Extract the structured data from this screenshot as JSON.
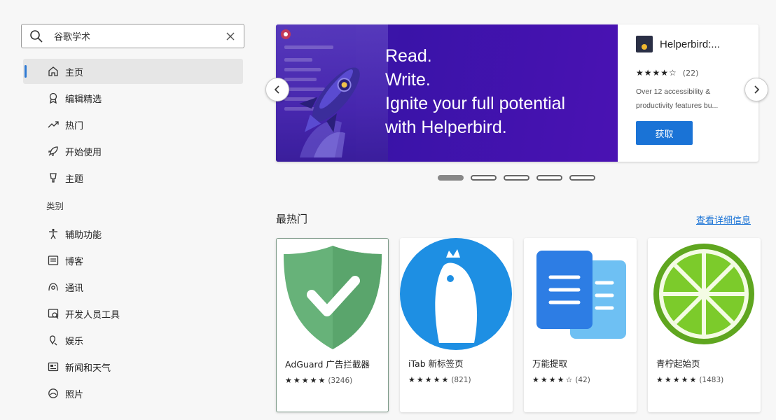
{
  "search": {
    "value": "谷歌学术"
  },
  "nav": {
    "items": [
      {
        "label": "主页",
        "icon": "home-icon",
        "active": true
      },
      {
        "label": "编辑精选",
        "icon": "award-icon"
      },
      {
        "label": "热门",
        "icon": "trending-icon"
      },
      {
        "label": "开始使用",
        "icon": "rocket-icon"
      },
      {
        "label": "主题",
        "icon": "theme-icon"
      }
    ],
    "category_heading": "类别",
    "categories": [
      {
        "label": "辅助功能",
        "icon": "accessibility-icon"
      },
      {
        "label": "博客",
        "icon": "blog-icon"
      },
      {
        "label": "通讯",
        "icon": "communication-icon"
      },
      {
        "label": "开发人员工具",
        "icon": "developer-tools-icon"
      },
      {
        "label": "娱乐",
        "icon": "entertainment-icon"
      },
      {
        "label": "新闻和天气",
        "icon": "news-icon"
      },
      {
        "label": "照片",
        "icon": "photo-icon"
      }
    ]
  },
  "banner": {
    "headline": [
      "Read.",
      "Write.",
      "Ignite your full potential",
      "with Helperbird."
    ],
    "app_title": "Helperbird:...",
    "stars": "★★★★☆",
    "rating_count": "(22)",
    "description": "Over 12 accessibility & productivity features bu...",
    "get_label": "获取",
    "slide_count": 5,
    "active_slide": 0,
    "accent": "#3a13a8"
  },
  "section": {
    "title": "最热门",
    "more_label": "查看详细信息",
    "cards": [
      {
        "name": "AdGuard 广告拦截器",
        "stars": "★★★★★",
        "count": "(3246)",
        "icon": "adguard-shield-icon"
      },
      {
        "name": "iTab 新标签页",
        "stars": "★★★★★",
        "count": "(821)",
        "icon": "itab-penguin-icon"
      },
      {
        "name": "万能提取",
        "stars": "★★★★☆",
        "count": "(42)",
        "icon": "document-icon"
      },
      {
        "name": "青柠起始页",
        "stars": "★★★★★",
        "count": "(1483)",
        "icon": "lime-icon"
      }
    ]
  },
  "colors": {
    "primary": "#1a73d6",
    "adguard": "#67b279",
    "itab": "#1e8fe3",
    "docs": "#2d7de4",
    "lime": "#7ccb2b"
  }
}
